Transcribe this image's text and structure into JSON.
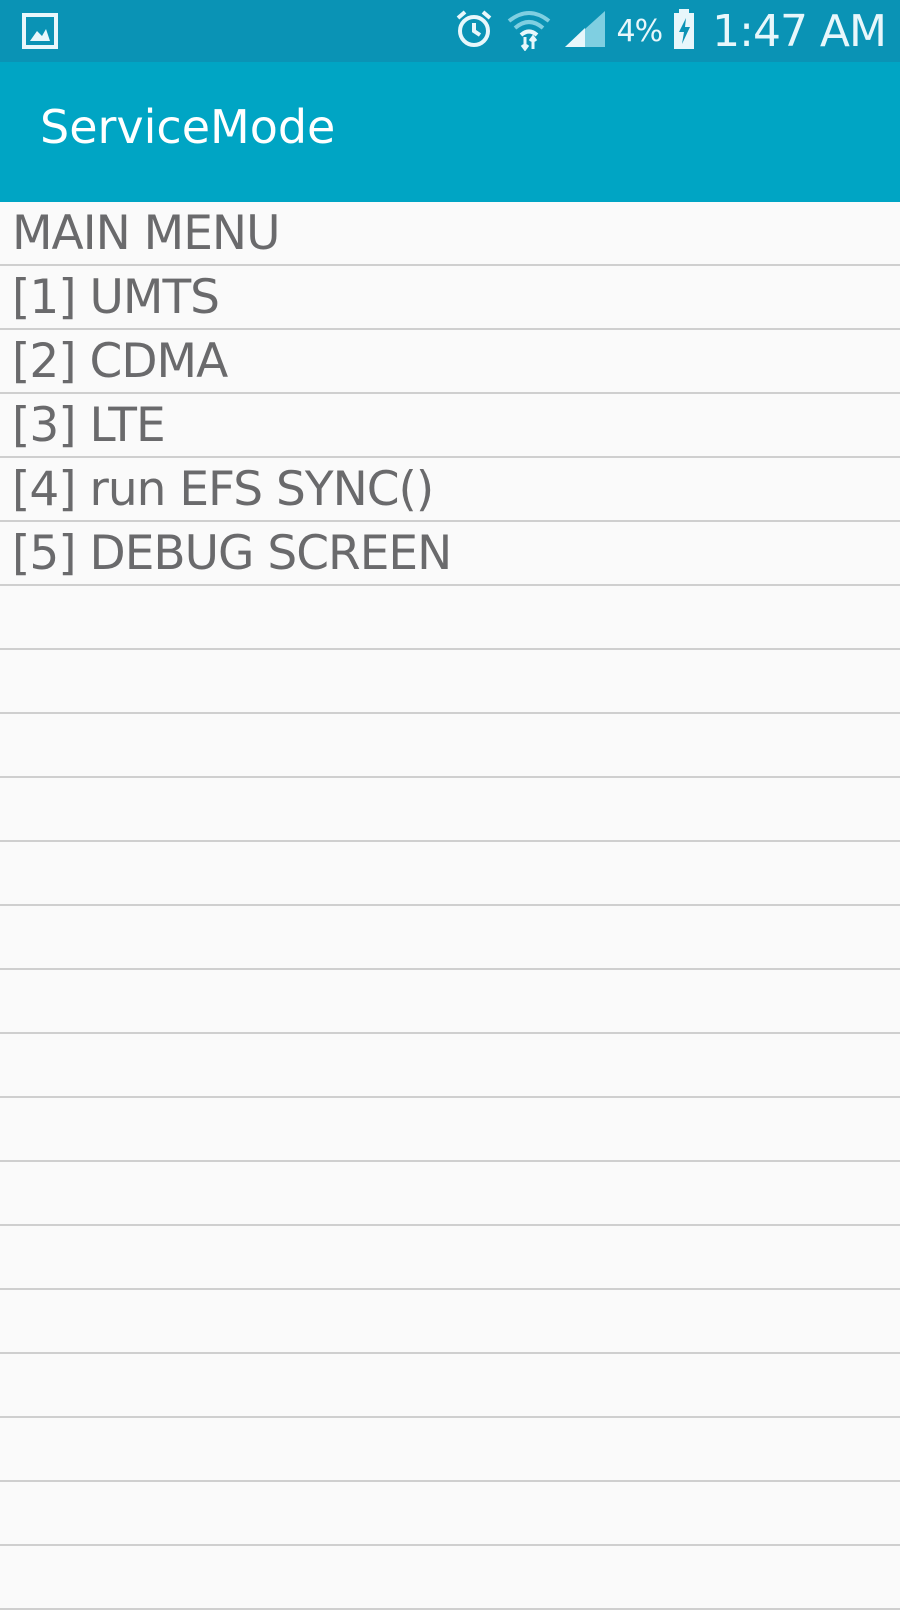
{
  "status_bar": {
    "left_icon": "gallery-notification-icon",
    "icons": [
      "alarm-icon",
      "wifi-icon",
      "signal-icon",
      "battery-charging-icon"
    ],
    "battery_percent": "4%",
    "time": "1:47 AM",
    "background": "#0a93b5"
  },
  "app_bar": {
    "title": "ServiceMode",
    "background": "#00a5c4"
  },
  "menu": {
    "rows": [
      {
        "label": "MAIN MENU"
      },
      {
        "label": "[1] UMTS"
      },
      {
        "label": "[2] CDMA"
      },
      {
        "label": "[3] LTE"
      },
      {
        "label": "[4] run EFS SYNC()"
      },
      {
        "label": "[5] DEBUG SCREEN"
      },
      {
        "label": ""
      },
      {
        "label": ""
      },
      {
        "label": ""
      },
      {
        "label": ""
      },
      {
        "label": ""
      },
      {
        "label": ""
      },
      {
        "label": ""
      },
      {
        "label": ""
      },
      {
        "label": ""
      },
      {
        "label": ""
      },
      {
        "label": ""
      },
      {
        "label": ""
      },
      {
        "label": ""
      },
      {
        "label": ""
      },
      {
        "label": ""
      },
      {
        "label": ""
      }
    ]
  },
  "colors": {
    "text": "#6a6a6c",
    "divider": "#cfcfcf",
    "page_background": "#fafafa"
  }
}
